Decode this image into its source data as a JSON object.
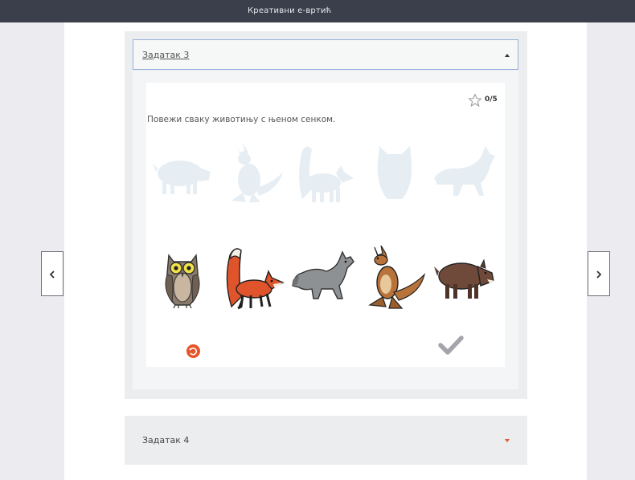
{
  "topbar": {
    "title": "Креативни е-вртић"
  },
  "task3": {
    "header_label": "Задатак 3",
    "score": "0/5",
    "instruction": "Повежи сваку животињу с њеном сенком.",
    "shadows": [
      "boar-shadow",
      "kangaroo-shadow",
      "fox-shadow",
      "owl-shadow",
      "wolf-shadow"
    ],
    "animals": [
      "owl",
      "fox",
      "wolf",
      "kangaroo",
      "boar"
    ]
  },
  "task4": {
    "header_label": "Задатак 4"
  },
  "colors": {
    "topbar": "#3b3e4b",
    "accent": "#e8542a",
    "shadow": "#e6eef3",
    "header_border": "#9ab0dc"
  },
  "icons": {
    "score": "star-outline-icon",
    "reset": "reset-icon",
    "submit": "checkmark-icon",
    "prev": "chevron-left-icon",
    "next": "chevron-right-icon"
  }
}
